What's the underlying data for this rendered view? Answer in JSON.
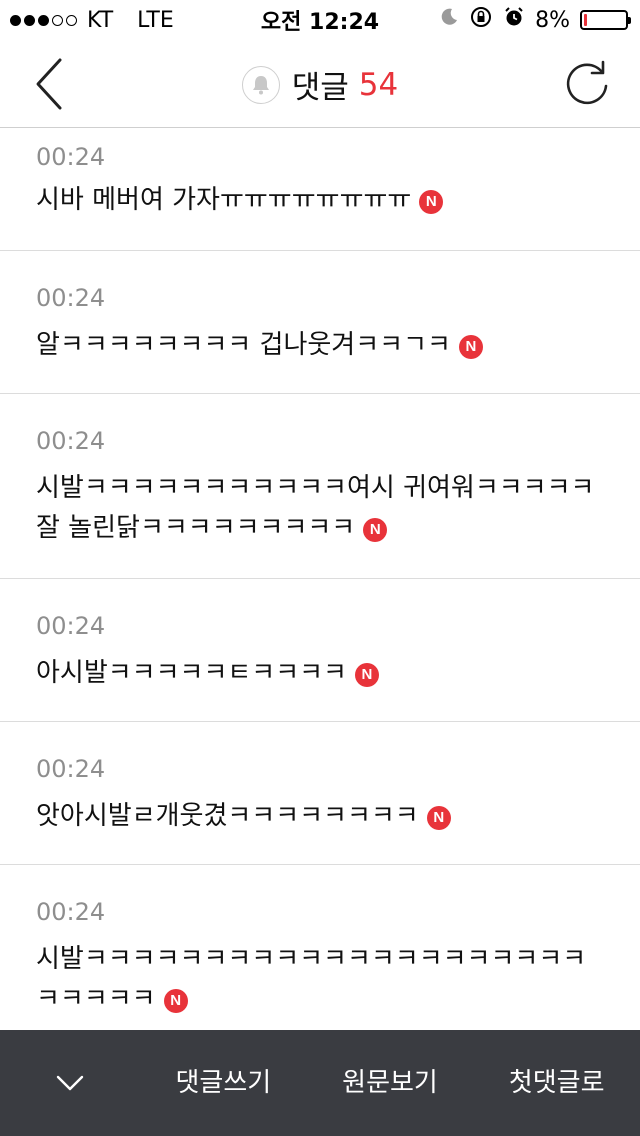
{
  "status_bar": {
    "carrier": "KT",
    "network": "LTE",
    "time": "오전 12:24",
    "battery_text": "8%",
    "battery_level": 0.08,
    "signal_bars_filled": 3,
    "signal_bars_total": 5,
    "colors": {
      "battery_low": "#e8333a"
    }
  },
  "header": {
    "title": "댓글",
    "count": "54",
    "icons": {
      "back": "chevron-left-icon",
      "bell": "bell-icon",
      "refresh": "refresh-icon"
    },
    "colors": {
      "count": "#e8333a"
    }
  },
  "comments": [
    {
      "time": "00:24",
      "text": "시바 메버여 가자ㅠㅠㅠㅠㅠㅠㅠㅠ",
      "badge": "N"
    },
    {
      "time": "00:24",
      "text": "알ㅋㅋㅋㅋㅋㅋㅋㅋ 겁나웃겨ㅋㅋㄱㅋ",
      "badge": "N"
    },
    {
      "time": "00:24",
      "text": "시발ㅋㅋㅋㅋㅋㅋㅋㅋㅋㅋㅋ여시 귀여워ㅋㅋㅋㅋㅋ잘 놀린닭ㅋㅋㅋㅋㅋㅋㅋㅋㅋ",
      "badge": "N"
    },
    {
      "time": "00:24",
      "text": "아시발ㅋㅋㅋㅋㅋㅌㅋㅋㅋㅋ",
      "badge": "N"
    },
    {
      "time": "00:24",
      "text": "앗아시발ㄹ개웃겼ㅋㅋㅋㅋㅋㅋㅋㅋ",
      "badge": "N"
    },
    {
      "time": "00:24",
      "text": "시발ㅋㅋㅋㅋㅋㅋㅋㅋㅋㅋㅋㅋㅋㅋㅋㅋㅋㅋㅋㅋㅋㅋㅋㅋㅋㅋ",
      "badge": "N"
    }
  ],
  "bottom_bar": {
    "collapse_icon": "chevron-down-icon",
    "write_label": "댓글쓰기",
    "original_label": "원문보기",
    "first_label": "첫댓글로",
    "colors": {
      "background": "#3a3c41",
      "text": "#ffffff",
      "badge": "#e8333a"
    }
  }
}
